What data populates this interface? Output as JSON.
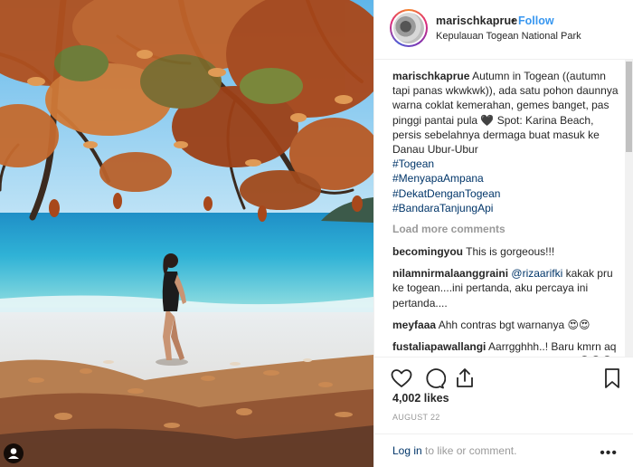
{
  "post": {
    "username": "marischkaprue",
    "follow_label": "Follow",
    "location": "Kepulauan Togean National Park"
  },
  "caption": {
    "username": "marischkaprue",
    "text": "Autumn in Togean ((autumn tapi panas wkwkwk)), ada satu pohon daunnya warna coklat kemerahan, gemes banget, pas pinggi pantai pula 🖤 Spot: Karina Beach, persis sebelahnya dermaga buat masuk ke Danau Ubur-Ubur",
    "hashtags": [
      "#Togean",
      "#MenyapaAmpana",
      "#DekatDenganTogean",
      "#BandaraTanjungApi"
    ]
  },
  "load_more": "Load more comments",
  "comments": [
    {
      "username": "becomingyou",
      "mention": "",
      "text": "This is gorgeous!!!"
    },
    {
      "username": "nilamnirmalaanggraini",
      "mention": "@rizaarifki",
      "text": "kakak pru ke togean....ini pertanda, aku percaya ini pertanda...."
    },
    {
      "username": "meyfaaa",
      "mention": "",
      "text": "Ahh contras bgt warnanya 😍😍"
    },
    {
      "username": "fustaliapawallangi",
      "mention": "",
      "text": "Aarrgghhh..! Baru kmrn aq jg dr tmp ini, unik bgt warna daunnya.. 😍😍😍"
    }
  ],
  "likes": "4,002 likes",
  "date": "AUGUST 22",
  "login": {
    "link": "Log in",
    "rest": " to like or comment."
  },
  "icons": {
    "like": "heart-icon",
    "comment": "comment-icon",
    "share": "share-icon",
    "save": "bookmark-icon",
    "more": "more-options-icon",
    "user_tag": "user-tag-icon"
  },
  "colors": {
    "link": "#003569",
    "follow": "#3897f0",
    "muted": "#999999"
  }
}
